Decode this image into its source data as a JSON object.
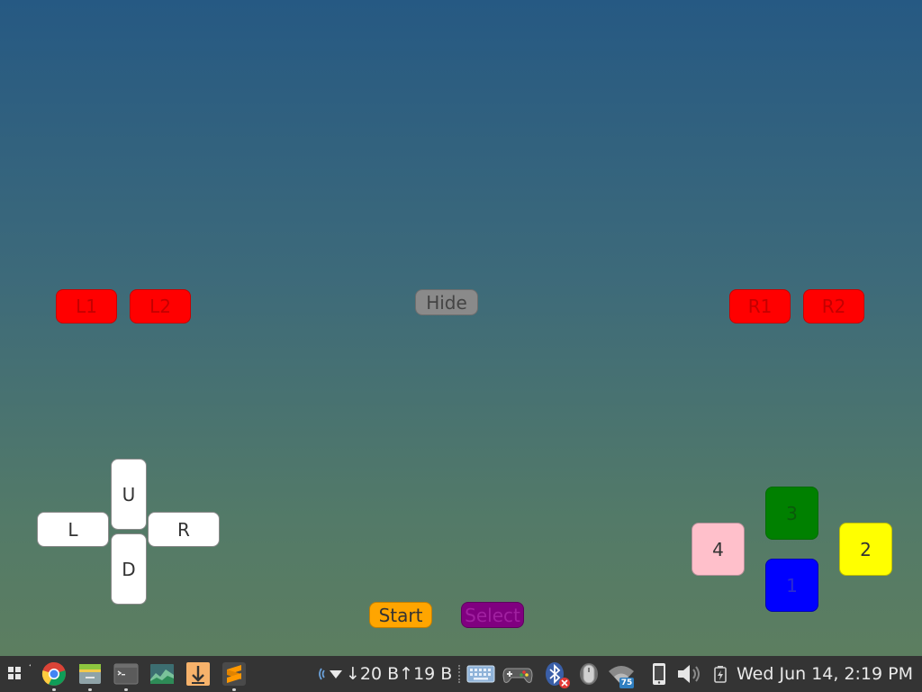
{
  "controller": {
    "l1": "L1",
    "l2": "L2",
    "r1": "R1",
    "r2": "R2",
    "hide": "Hide",
    "dpad_up": "U",
    "dpad_down": "D",
    "dpad_left": "L",
    "dpad_right": "R",
    "btn1": "1",
    "btn2": "2",
    "btn3": "3",
    "btn4": "4",
    "start": "Start",
    "select": "Select"
  },
  "taskbar": {
    "apps": [
      "app-grid-icon",
      "chrome-icon",
      "file-manager-icon",
      "terminal-icon",
      "system-monitor-icon",
      "download-manager-icon",
      "sublime-text-icon"
    ],
    "tray": {
      "net_speed": "↓20 B↑19 B",
      "wifi_signal": "75",
      "clock": "Wed Jun 14,  2:19 PM"
    }
  },
  "colors": {
    "shoulder": "#ff0000",
    "hide": "#8a8a8a",
    "dpad": "#ffffff",
    "btn1": "#0000ff",
    "btn2": "#ffff00",
    "btn3": "#008000",
    "btn4": "#ffc0cb",
    "start": "#ffa500",
    "select": "#800080",
    "taskbar": "#343434"
  }
}
